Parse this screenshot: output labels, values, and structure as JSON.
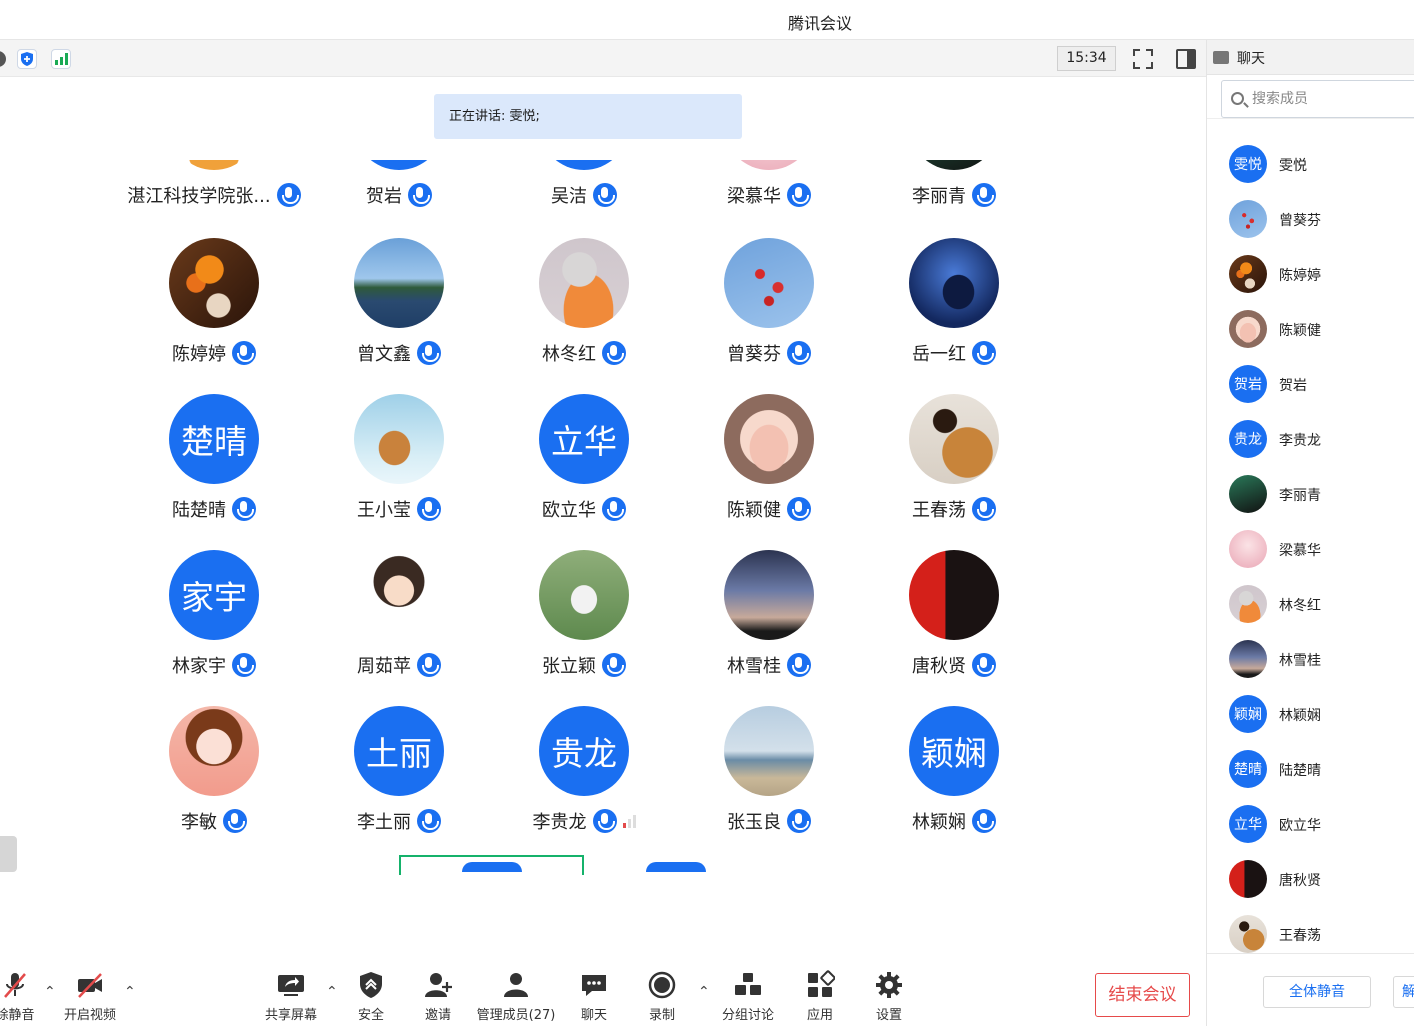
{
  "app": {
    "title": "腾讯会议"
  },
  "toolbar": {
    "time": "15:34"
  },
  "speaking": {
    "text": "正在讲话: 雯悦;"
  },
  "gallery": {
    "top_row": [
      {
        "name": "湛江科技学院张...",
        "photo": "orange"
      },
      {
        "name": "贺岩",
        "photo": "blue"
      },
      {
        "name": "吴洁",
        "photo": "blue"
      },
      {
        "name": "梁慕华",
        "photo": "pink"
      },
      {
        "name": "李丽青",
        "photo": "teal"
      }
    ],
    "rows": [
      [
        {
          "name": "陈婷婷",
          "photo": "flowers-orange"
        },
        {
          "name": "曾文鑫",
          "photo": "lake"
        },
        {
          "name": "林冬红",
          "photo": "cat"
        },
        {
          "name": "曾葵芬",
          "photo": "blossom"
        },
        {
          "name": "岳一红",
          "photo": "silhouette"
        }
      ],
      [
        {
          "name": "陆楚晴",
          "initials": "楚晴"
        },
        {
          "name": "王小莹",
          "photo": "fox"
        },
        {
          "name": "欧立华",
          "initials": "立华"
        },
        {
          "name": "陈颖健",
          "photo": "pig"
        },
        {
          "name": "王春荡",
          "photo": "woman-dog"
        }
      ],
      [
        {
          "name": "林家宇",
          "initials": "家宇"
        },
        {
          "name": "周茹苹",
          "photo": "cartoon-girl"
        },
        {
          "name": "张立颖",
          "photo": "astronaut"
        },
        {
          "name": "林雪桂",
          "photo": "dusk"
        },
        {
          "name": "唐秋贤",
          "photo": "flag"
        }
      ],
      [
        {
          "name": "李敏",
          "photo": "painted-girl"
        },
        {
          "name": "李土丽",
          "initials": "土丽"
        },
        {
          "name": "李贵龙",
          "initials": "贵龙",
          "signal": true
        },
        {
          "name": "张玉良",
          "photo": "beach"
        },
        {
          "name": "林颖娴",
          "initials": "颖娴"
        }
      ]
    ]
  },
  "bottom": {
    "mute": "除静音",
    "video": "开启视频",
    "share": "共享屏幕",
    "security": "安全",
    "invite": "邀请",
    "members": "管理成员(27)",
    "chat": "聊天",
    "record": "录制",
    "breakout": "分组讨论",
    "apps": "应用",
    "settings": "设置",
    "end": "结束会议"
  },
  "panel": {
    "header": "聊天",
    "search_placeholder": "搜索成员",
    "members": [
      {
        "name": "雯悦",
        "initials": "雯悦"
      },
      {
        "name": "曾葵芬",
        "photo": "blossom"
      },
      {
        "name": "陈婷婷",
        "photo": "flowers-orange"
      },
      {
        "name": "陈颖健",
        "photo": "pig"
      },
      {
        "name": "贺岩",
        "initials": "贺岩"
      },
      {
        "name": "李贵龙",
        "initials": "贵龙"
      },
      {
        "name": "李丽青",
        "photo": "teal"
      },
      {
        "name": "梁慕华",
        "photo": "pink"
      },
      {
        "name": "林冬红",
        "photo": "cat"
      },
      {
        "name": "林雪桂",
        "photo": "dusk"
      },
      {
        "name": "林颖娴",
        "initials": "颖娴"
      },
      {
        "name": "陆楚晴",
        "initials": "楚晴"
      },
      {
        "name": "欧立华",
        "initials": "立华"
      },
      {
        "name": "唐秋贤",
        "photo": "flag"
      },
      {
        "name": "王春荡",
        "photo": "woman-dog"
      }
    ],
    "mute_all": "全体静音",
    "unmute_all": "解"
  }
}
